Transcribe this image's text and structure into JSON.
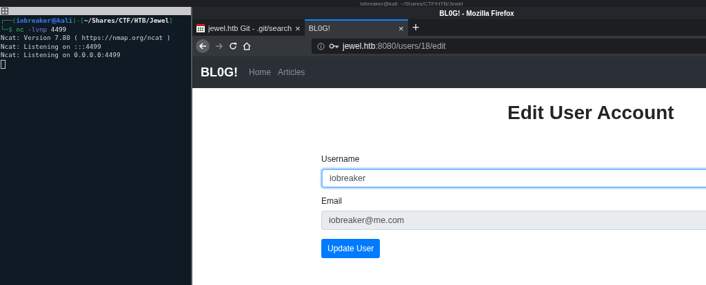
{
  "desktop_title": "iobreaker@kali: ~/Shares/CTF/HTB/Jewel",
  "terminal": {
    "prompt": [
      {
        "kind": "frame",
        "text": "┌──("
      },
      {
        "kind": "user",
        "text": "iobreaker㉿kali"
      },
      {
        "kind": "frame",
        "text": ")-["
      },
      {
        "kind": "path",
        "text": "~/Shares/CTF/HTB/Jewel"
      },
      {
        "kind": "frame",
        "text": "]"
      }
    ],
    "command": [
      {
        "kind": "frame",
        "text": "└─$"
      },
      {
        "kind": "cmd",
        "text": "nc"
      },
      {
        "kind": "flag",
        "text": "-lvnp"
      },
      {
        "kind": "plain",
        "text": "4499"
      }
    ],
    "output": [
      "Ncat: Version 7.80 ( https://nmap.org/ncat )",
      "Ncat: Listening on :::4499",
      "Ncat: Listening on 0.0.0.0:4499"
    ]
  },
  "browser": {
    "title": "BL0G! - Mozilla Firefox",
    "tabs": [
      {
        "label": "jewel.htb Git - .git/search",
        "selected": false,
        "favicon": true
      },
      {
        "label": "BL0G!",
        "selected": true,
        "favicon": false
      }
    ],
    "close_glyph": [
      "×",
      "×"
    ],
    "new_tab": "+",
    "url": {
      "host": "jewel.htb",
      "rest": ":8080/users/18/edit"
    },
    "page": {
      "brand": "BL0G!",
      "nav": [
        "Home",
        "Articles"
      ],
      "heading": "Edit User Account",
      "fields": [
        {
          "label": "Username",
          "value": "iobreaker",
          "focused": true,
          "disabled": false
        },
        {
          "label": "Email",
          "value": "iobreaker@me.com",
          "focused": false,
          "disabled": true
        }
      ],
      "button": "Update User"
    }
  }
}
